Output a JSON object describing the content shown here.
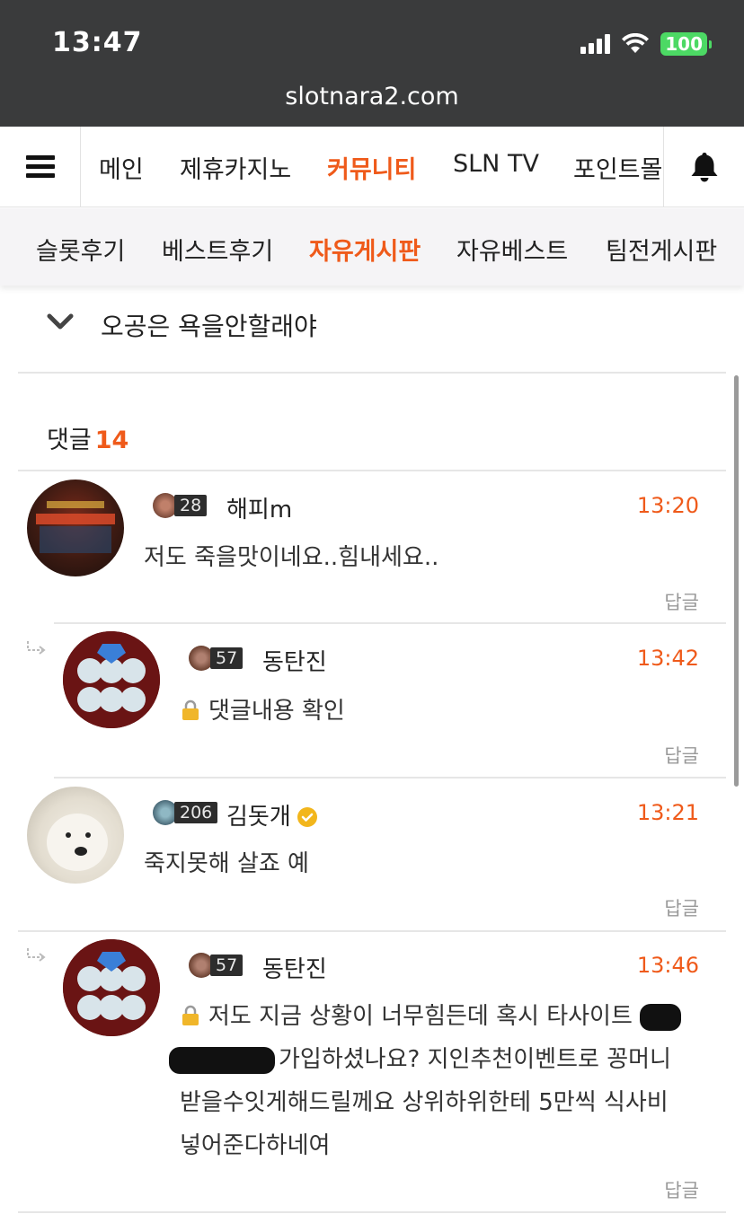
{
  "status_bar": {
    "time": "13:47",
    "battery": "100",
    "url": "slotnara2.com"
  },
  "nav": {
    "items": [
      {
        "label": "메인"
      },
      {
        "label": "제휴카지노"
      },
      {
        "label": "커뮤니티"
      },
      {
        "label": "SLN TV"
      },
      {
        "label": "포인트몰"
      }
    ],
    "active": "커뮤니티"
  },
  "subnav": {
    "items": [
      {
        "label": "슬롯후기"
      },
      {
        "label": "베스트후기"
      },
      {
        "label": "자유게시판"
      },
      {
        "label": "자유베스트"
      },
      {
        "label": "팀전게시판"
      }
    ],
    "active": "자유게시판"
  },
  "post": {
    "title": "오공은 욕을안할래야"
  },
  "comments_header": {
    "label": "댓글",
    "count": "14"
  },
  "comments": [
    {
      "level": "28",
      "nickname": "해피m",
      "time": "13:20",
      "text": "저도 죽을맛이네요..힘내세요..",
      "reply": "답글",
      "is_reply": false
    },
    {
      "level": "57",
      "nickname": "동탄진",
      "time": "13:42",
      "text": "댓글내용 확인",
      "secret": true,
      "reply": "답글",
      "is_reply": true
    },
    {
      "level": "206",
      "nickname": "김돗개",
      "time": "13:21",
      "text": "죽지못해 살죠 예",
      "verified": true,
      "reply": "답글",
      "is_reply": false
    },
    {
      "level": "57",
      "nickname": "동탄진",
      "time": "13:46",
      "secret": true,
      "text_lines": [
        "저도 지금 상황이 너무힘든데 혹시 타사이트",
        "가입하셨나요? 지인추천이벤트로 꽁머니",
        "받을수잇게해드릴께요 상위하위한테 5만씩 식사비",
        "넣어준다하네여"
      ],
      "reply": "답글",
      "is_reply": true
    }
  ],
  "colors": {
    "accent": "#ef5a1a",
    "status_bg": "#3a3b3c",
    "subnav_bg": "#f5f4f6"
  },
  "icons": [
    "hamburger-icon",
    "bell-icon",
    "chevron-down-icon",
    "lock-icon",
    "reply-arrow-icon",
    "verified-icon",
    "wifi-icon",
    "signal-icon",
    "battery-icon"
  ]
}
